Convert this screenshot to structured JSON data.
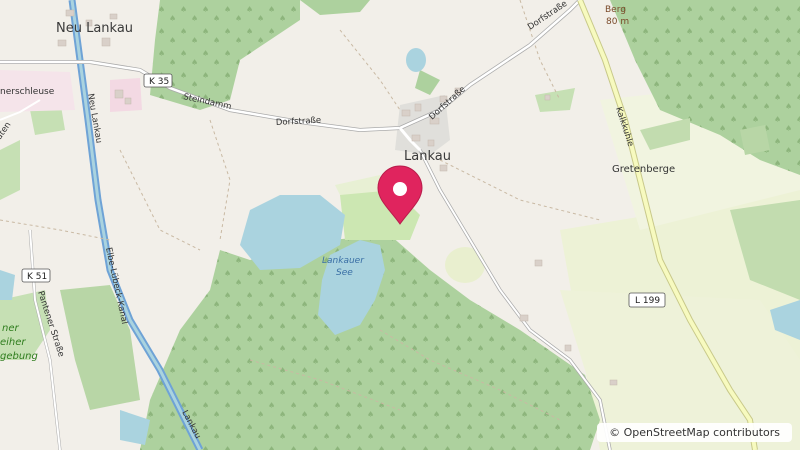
{
  "map": {
    "places": {
      "neu_lankau": "Neu Lankau",
      "lankau": "Lankau",
      "gretenberge": "Gretenberge",
      "schleuse_partial": "nerschleuse",
      "berg_name": "Berg",
      "berg_elevation": "80 m"
    },
    "roads": {
      "steindamm": "Steindamm",
      "dorfstrasse_west": "Dorfstraße",
      "dorfstrasse_east": "Dorfstraße",
      "dorfstrasse_north": "Dorfstraße",
      "kalkkuhle": "Kalkkuhle",
      "lankau_road": "Lankau",
      "pantener_strasse": "Pantener Straße",
      "canal": "Elbe-Lübeck-Kanal",
      "partial_west": "aten"
    },
    "shields": {
      "k35": "K 35",
      "k51": "K 51",
      "l199": "L 199"
    },
    "water": {
      "lake_line1": "Lankauer",
      "lake_line2": "See"
    },
    "green_area": {
      "line1": "ner",
      "line2": "eiher",
      "line3": "gebung"
    },
    "marker": {
      "color": "#e0245e",
      "icon": "map-pin-icon"
    },
    "attribution": "© OpenStreetMap contributors"
  },
  "colors": {
    "background": "#f2efe9",
    "forest": "#add19e",
    "water": "#aad3df",
    "canal": "#6fa3d6",
    "road_yellow": "#f7fabf",
    "meadow": "#e8f0d4"
  }
}
